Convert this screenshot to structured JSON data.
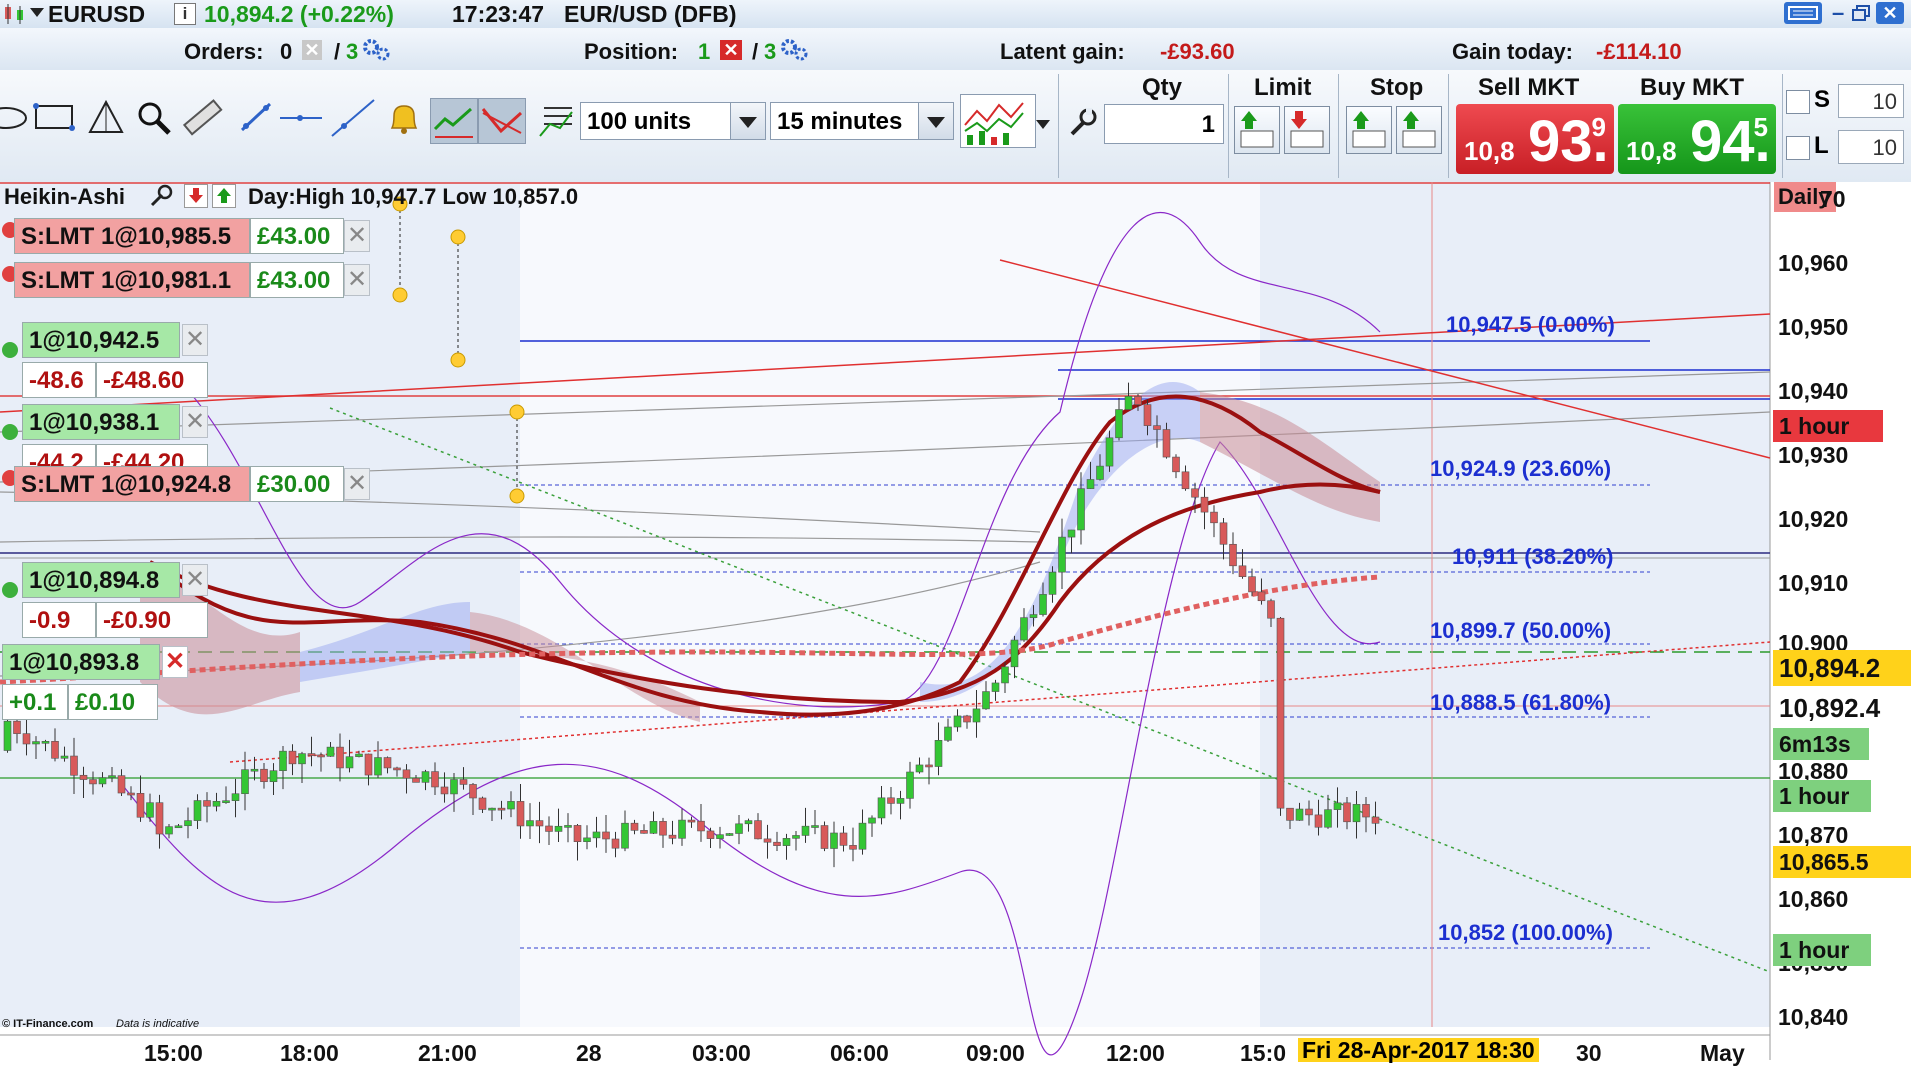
{
  "title_bar": {
    "symbol": "EURUSD",
    "info_icon": "info-icon",
    "price_change": "10,894.2 (+0.22%)",
    "time": "17:23:47",
    "instrument": "EUR/USD (DFB)",
    "win_controls": [
      "keyboard-icon",
      "minimize-icon",
      "restore-icon",
      "close-icon"
    ]
  },
  "summary": {
    "orders_label": "Orders:",
    "orders_count": "0",
    "orders_of": "/",
    "orders_total": "3",
    "position_label": "Position:",
    "position_count": "1",
    "position_of": "/",
    "position_total": "3",
    "latent_label": "Latent gain:",
    "latent_value": "-£93.60",
    "today_label": "Gain today:",
    "today_value": "-£114.10"
  },
  "toolbar": {
    "units": "100 units",
    "timeframe": "15 minutes",
    "qty_label": "Qty",
    "qty_value": "1",
    "limit_label": "Limit",
    "stop_label": "Stop",
    "sell_label": "Sell MKT",
    "buy_label": "Buy MKT",
    "sell_small": "10,8",
    "sell_big": "93.",
    "sell_sup": "9",
    "buy_small": "10,8",
    "buy_big": "94.",
    "buy_sup": "5",
    "s_label": "S",
    "s_value": "10",
    "l_label": "L",
    "l_value": "10"
  },
  "chart_header": {
    "style": "Heikin-Ashi",
    "day_text": "Day:High 10,947.7 Low 10,857.0",
    "daily_tag": "Daily"
  },
  "order_labels": [
    {
      "text": "S:LMT 1@10,985.5",
      "gain": "£43.00"
    },
    {
      "text": "S:LMT 1@10,981.1",
      "gain": "£43.00"
    },
    {
      "text": "1@10,942.5",
      "pts": "-48.6",
      "money": "-£48.60"
    },
    {
      "text": "1@10,938.1",
      "pts": "-44.2",
      "money": "-£44.20"
    },
    {
      "text": "S:LMT 1@10,924.8",
      "gain": "£30.00"
    },
    {
      "text": "1@10,894.8",
      "pts": "-0.9",
      "money": "-£0.90"
    },
    {
      "text": "1@10,893.8",
      "pts": "+0.1",
      "money": "£0.10"
    }
  ],
  "fib_levels": [
    "10,947.5 (0.00%)",
    "10,924.9 (23.60%)",
    "10,911 (38.20%)",
    "10,899.7 (50.00%)",
    "10,888.5 (61.80%)",
    "10,852 (100.00%)"
  ],
  "price_axis": {
    "ticks": [
      "10,960",
      "10,950",
      "10,940",
      "10,930",
      "10,920",
      "10,910",
      "10,900",
      "10,880",
      "10,870",
      "10,860",
      "10,850",
      "10,840"
    ],
    "tags": {
      "hour1": "1 hour",
      "hour2": "1 hour",
      "hour3": "1 hour",
      "current": "10,894.2",
      "last": "10,892.4",
      "countdown": "6m13s",
      "level": "10,865.5",
      "top_partial": "70"
    }
  },
  "time_axis": {
    "labels": [
      "15:00",
      "18:00",
      "21:00",
      "28",
      "03:00",
      "06:00",
      "09:00",
      "12:00",
      "15:0",
      "30",
      "May"
    ],
    "cursor_date": "Fri 28-Apr-2017 18:30"
  },
  "footer": {
    "copyright": "© IT-Finance.com",
    "note": "Data is indicative"
  },
  "colors": {
    "up": "#34c634",
    "down": "#d85a5a",
    "ma": "#9b1010",
    "fib": "#1c2fd0",
    "band": "#8a28c8",
    "sell": "#e0323a",
    "buy": "#1fae1f"
  },
  "chart_data": {
    "type": "candlestick",
    "title": "",
    "xlabel": "",
    "ylabel": "",
    "ylim": [
      10837,
      10972
    ],
    "series": [
      {
        "name": "",
        "x": [
          "15:00",
          "18:00",
          "21:00",
          "28",
          "03:00",
          "06:00",
          "09:00",
          "12:00",
          "15:00"
        ],
        "values": [
          10866,
          10880,
          10876,
          10866,
          10868,
          10866,
          10890,
          10936,
          10899
        ]
      }
    ]
  }
}
